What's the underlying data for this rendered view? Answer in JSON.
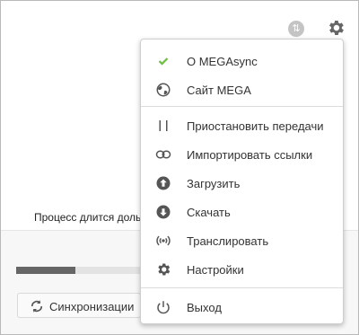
{
  "status": {
    "text": "Процесс длится дольш"
  },
  "progress": {
    "fraction": 0.47
  },
  "bottom_bar": {
    "sync_label": "Синхронизации"
  },
  "menu": {
    "items": [
      {
        "label": "О MEGAsync",
        "icon": "check-icon"
      },
      {
        "label": "Сайт MEGA",
        "icon": "globe-icon"
      },
      {
        "label": "Приостановить передачи",
        "icon": "pause-icon"
      },
      {
        "label": "Импортировать ссылки",
        "icon": "link-icon"
      },
      {
        "label": "Загрузить",
        "icon": "upload-icon"
      },
      {
        "label": "Скачать",
        "icon": "download-icon"
      },
      {
        "label": "Транслировать",
        "icon": "stream-icon"
      },
      {
        "label": "Настройки",
        "icon": "gear-icon"
      },
      {
        "label": "Выход",
        "icon": "power-icon"
      }
    ]
  },
  "colors": {
    "accent_check": "#6cbe45",
    "icon_gray": "#555555",
    "progress_fill": "#666666"
  }
}
